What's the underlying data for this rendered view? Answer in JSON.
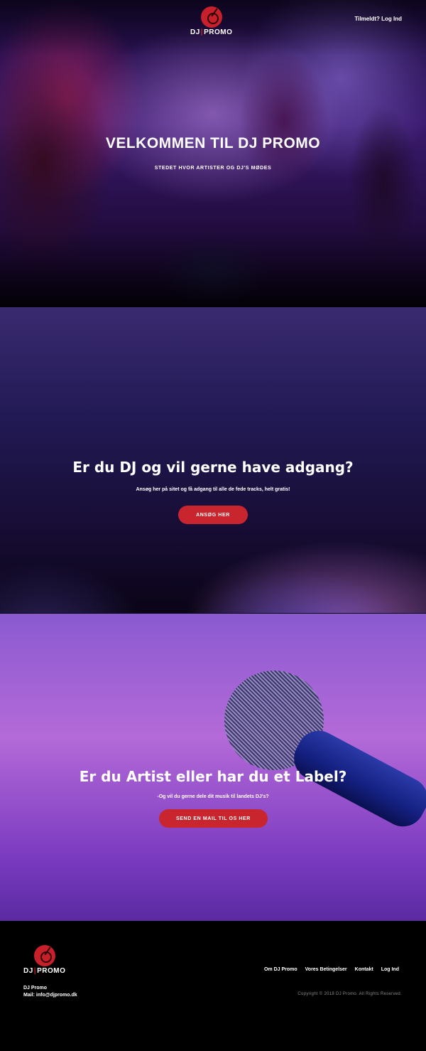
{
  "header": {
    "logo_text_left": "DJ",
    "logo_text_right": "PROMO",
    "nav_label": "Tilmeldt? Log Ind"
  },
  "hero": {
    "title": "VELKOMMEN TIL DJ PROMO",
    "subtitle": "STEDET HVOR ARTISTER OG DJ'S MØDES"
  },
  "dj_section": {
    "title": "Er du DJ og vil gerne have adgang?",
    "subtitle": "Ansøg her på sitet og få adgang til alle de fede tracks, helt gratis!",
    "button": "ANSØG HER"
  },
  "artist_section": {
    "title": "Er du Artist eller har du et Label?",
    "subtitle": "-Og vil du gerne dele dit musik til landets DJ's?",
    "button": "SEND EN MAIL TIL OS HER"
  },
  "footer": {
    "logo_text_left": "DJ",
    "logo_text_right": "PROMO",
    "nav": [
      "Om DJ Promo",
      "Vores Betingelser",
      "Kontakt",
      "Log Ind"
    ],
    "company": "DJ Promo",
    "mail": "Mail: info@djpromo.dk",
    "copyright": "Copyright © 2018 DJ Promo. All Rights Reserved."
  },
  "colors": {
    "accent": "#c9252e",
    "footer_bg": "#000000"
  }
}
